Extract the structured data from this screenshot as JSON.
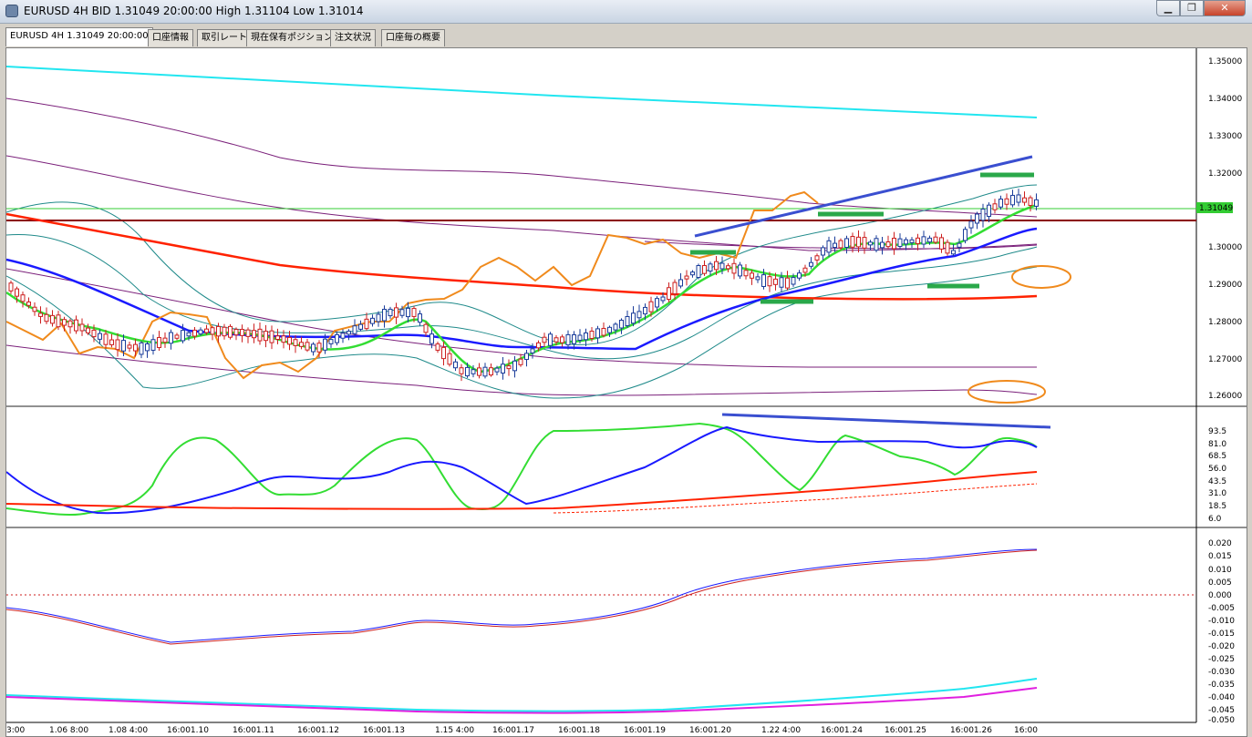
{
  "window": {
    "title": "EURUSD 4H BID 1.31049 20:00:00 High 1.31104 Low 1.31014",
    "buttons": {
      "minimize": "▁",
      "maximize": "❐",
      "close": "✕"
    }
  },
  "tabs": [
    {
      "label": "EURUSD 4H 1.31049 20:00:00",
      "active": true
    },
    {
      "label": "口座情報",
      "active": false
    },
    {
      "label": "取引レート",
      "active": false
    },
    {
      "label": "現在保有ポジション",
      "active": false
    },
    {
      "label": "注文状況",
      "active": false
    },
    {
      "label": "口座毎の概要",
      "active": false
    }
  ],
  "price_pane": {
    "current_price_label": "1.31049",
    "current_price": 1.31049,
    "axis_ticks": [
      "1.35000",
      "1.34000",
      "1.33000",
      "1.32000",
      "1.30000",
      "1.29000",
      "1.28000",
      "1.27000",
      "1.26000"
    ]
  },
  "stoch_pane": {
    "axis_ticks": [
      "93.5",
      "81.0",
      "68.5",
      "56.0",
      "43.5",
      "31.0",
      "18.5",
      "6.0"
    ]
  },
  "macd_pane": {
    "axis_ticks": [
      "0.020",
      "0.015",
      "0.010",
      "0.005",
      "0.000",
      "-0.005",
      "-0.010",
      "-0.015",
      "-0.020",
      "-0.025",
      "-0.030",
      "-0.035",
      "-0.040",
      "-0.045",
      "-0.050"
    ]
  },
  "time_axis": [
    "3:00",
    "1.06 8:00",
    "1.08 4:00",
    "16:001.10",
    "16:001.11",
    "16:001.12",
    "16:001.13",
    "1.15 4:00",
    "16:001.17",
    "16:001.18",
    "16:001.19",
    "16:001.20",
    "1.22 4:00",
    "16:001.24",
    "16:001.25",
    "16:001.26",
    "16:00"
  ],
  "colors": {
    "bull_candle": "#1a3c9a",
    "bear_candle": "#cc1f1f",
    "current_price_bg": "#33cc33",
    "ma_blue": "#1a1aff",
    "ma_red": "#ff2200",
    "ma_green": "#33dd33",
    "orange_line": "#f08a1c",
    "cyan_band": "#22e6f0",
    "purple_band": "#7a1f7a",
    "teal_band": "#1f8a8a",
    "support_line": "#8b0000",
    "annotation_green": "#2aa84a",
    "annotation_trend": "#3a4fd0",
    "annotation_circle": "#f08a1c"
  }
}
